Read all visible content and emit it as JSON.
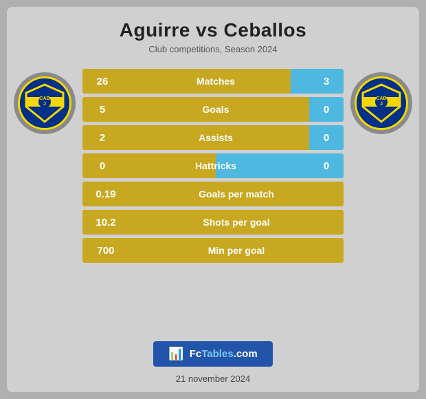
{
  "title": "Aguirre vs Ceballos",
  "subtitle": "Club competitions, Season 2024",
  "stats": [
    {
      "id": "matches",
      "label": "Matches",
      "left": "26",
      "right": "3",
      "leftPct": 90
    },
    {
      "id": "goals",
      "label": "Goals",
      "left": "5",
      "right": "0",
      "leftPct": 100
    },
    {
      "id": "assists",
      "label": "Assists",
      "left": "2",
      "right": "0",
      "leftPct": 100
    },
    {
      "id": "hattricks",
      "label": "Hattricks",
      "left": "0",
      "right": "0",
      "leftPct": 50
    }
  ],
  "single_stats": [
    {
      "id": "goals-per-match",
      "label": "Goals per match",
      "value": "0.19"
    },
    {
      "id": "shots-per-goal",
      "label": "Shots per goal",
      "value": "10.2"
    },
    {
      "id": "min-per-goal",
      "label": "Min per goal",
      "value": "700"
    }
  ],
  "logo": {
    "text_line1": "CAB",
    "text_line2": "J"
  },
  "banner": {
    "icon": "📊",
    "text_plain": "Fc",
    "text_highlight": "Tables",
    "text_suffix": ".com"
  },
  "footer_date": "21 november 2024"
}
